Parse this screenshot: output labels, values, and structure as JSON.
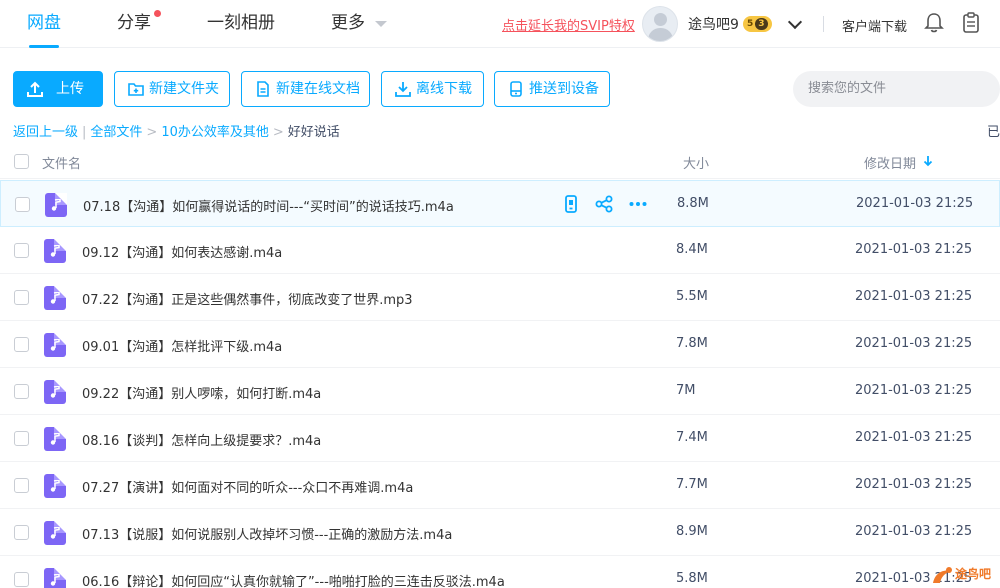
{
  "nav": {
    "items": [
      {
        "label": "网盘",
        "active": true
      },
      {
        "label": "分享",
        "active": false,
        "dot": true
      },
      {
        "label": "一刻相册",
        "active": false
      },
      {
        "label": "更多",
        "active": false
      }
    ],
    "svip_link": "点击延长我的SVIP特权",
    "username": "途鸟吧9",
    "vip_level": "5",
    "vip_sub": "3",
    "client_download": "客户端下载"
  },
  "toolbar": {
    "upload": "上传",
    "new_folder": "新建文件夹",
    "new_doc": "新建在线文档",
    "offline_download": "离线下载",
    "push_device": "推送到设备",
    "search_placeholder": "搜索您的文件"
  },
  "breadcrumb": {
    "back": "返回上一级",
    "all_files": "全部文件",
    "folder": "10办公效率及其他",
    "current": "好好说话",
    "loaded_label": "已"
  },
  "table": {
    "col_name": "文件名",
    "col_size": "大小",
    "col_date": "修改日期",
    "rows": [
      {
        "name": "07.18【沟通】如何赢得说话的时间---“买时间”的说话技巧.m4a",
        "size": "8.8M",
        "date": "2021-01-03 21:25"
      },
      {
        "name": "09.12【沟通】如何表达感谢.m4a",
        "size": "8.4M",
        "date": "2021-01-03 21:25"
      },
      {
        "name": "07.22【沟通】正是这些偶然事件，彻底改变了世界.mp3",
        "size": "5.5M",
        "date": "2021-01-03 21:25"
      },
      {
        "name": "09.01【沟通】怎样批评下级.m4a",
        "size": "7.8M",
        "date": "2021-01-03 21:25"
      },
      {
        "name": "09.22【沟通】别人啰嗦，如何打断.m4a",
        "size": "7M",
        "date": "2021-01-03 21:25"
      },
      {
        "name": "08.16【谈判】怎样向上级提要求？.m4a",
        "size": "7.4M",
        "date": "2021-01-03 21:25"
      },
      {
        "name": "07.27【演讲】如何面对不同的听众---众口不再难调.m4a",
        "size": "7.7M",
        "date": "2021-01-03 21:25"
      },
      {
        "name": "07.13【说服】如何说服别人改掉坏习惯---正确的激励方法.m4a",
        "size": "8.9M",
        "date": "2021-01-03 21:25"
      },
      {
        "name": "06.16【辩论】如何回应“认真你就输了”---啪啪打脸的三连击反驳法.m4a",
        "size": "5.8M",
        "date": "2021-01-03 21:25"
      }
    ]
  },
  "watermark": "途鸟吧",
  "colors": {
    "accent": "#09aaff",
    "red": "#f5525c",
    "audio_icon": "#7d66f5"
  }
}
